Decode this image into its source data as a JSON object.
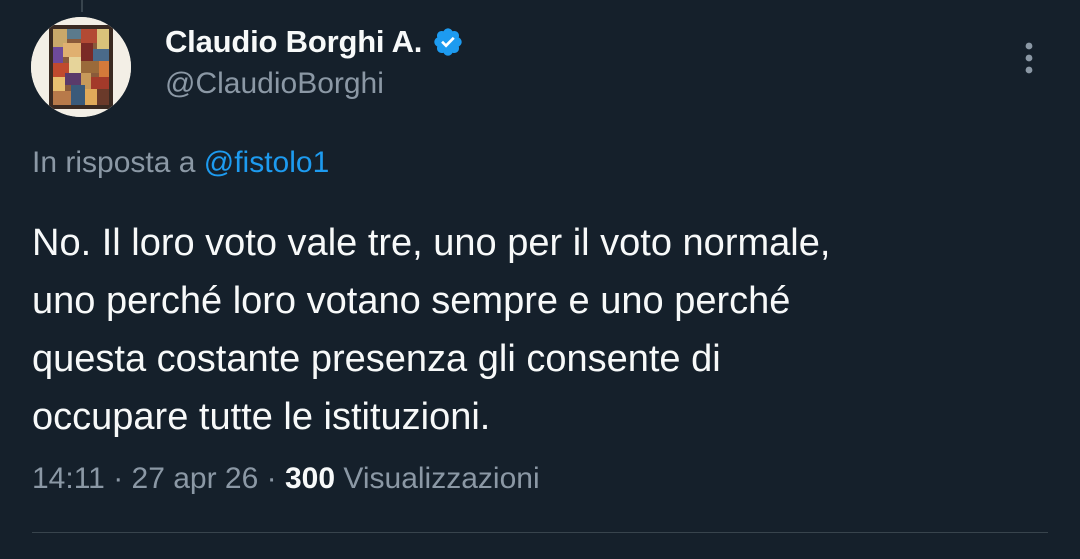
{
  "author": {
    "display_name": "Claudio Borghi A.",
    "handle": "@ClaudioBorghi",
    "verified": true,
    "avatar_icon": "abstract-painting-avatar"
  },
  "reply": {
    "prefix": "In risposta a",
    "mention": "@fistolo1"
  },
  "tweet": {
    "text": "No. Il loro voto vale tre, uno per il voto normale,\nuno perché loro votano sempre e uno perché\nquesta costante presenza gli consente di\noccupare tutte le istituzioni."
  },
  "meta": {
    "time": "14:11",
    "sep1": " · ",
    "date": "27 apr 26",
    "sep2": " · ",
    "views_count": "300",
    "views_label": "Visualizzazioni"
  },
  "colors": {
    "background": "#15202b",
    "text": "#f7f9f9",
    "secondary_text": "#8b98a5",
    "accent": "#1d9bf0",
    "divider": "#38444d"
  },
  "icons": {
    "verified": "verified-badge-icon",
    "more": "more-vertical-icon"
  }
}
